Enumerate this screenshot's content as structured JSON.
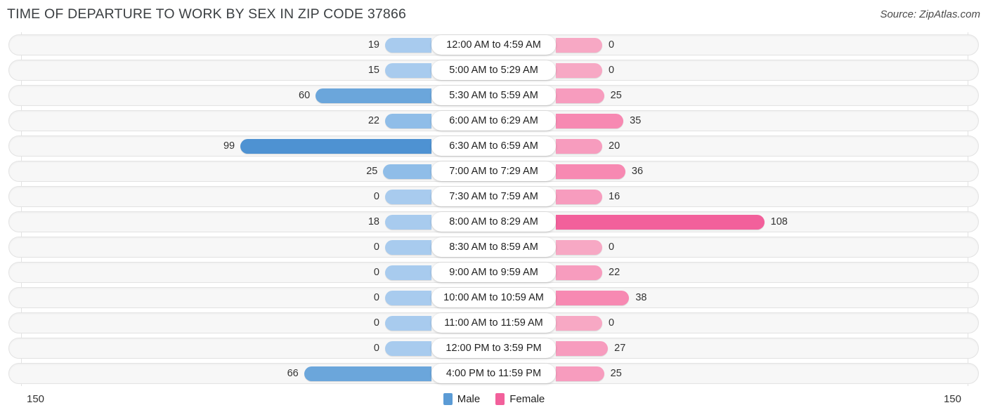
{
  "header": {
    "title": "TIME OF DEPARTURE TO WORK BY SEX IN ZIP CODE 37866",
    "source": "Source: ZipAtlas.com"
  },
  "legend": {
    "male_label": "Male",
    "female_label": "Female",
    "male_color": "#5b9bd5",
    "female_color": "#f2609b"
  },
  "axis": {
    "left_end": "150",
    "right_end": "150",
    "max": 150
  },
  "chart_data": {
    "type": "bar",
    "title": "TIME OF DEPARTURE TO WORK BY SEX IN ZIP CODE 37866",
    "subtitle": "Source: ZipAtlas.com",
    "orientation": "horizontal-diverging",
    "xlabel": "",
    "ylabel": "",
    "xlim": [
      150,
      150
    ],
    "grid": false,
    "legend_position": "bottom-center",
    "categories": [
      "12:00 AM to 4:59 AM",
      "5:00 AM to 5:29 AM",
      "5:30 AM to 5:59 AM",
      "6:00 AM to 6:29 AM",
      "6:30 AM to 6:59 AM",
      "7:00 AM to 7:29 AM",
      "7:30 AM to 7:59 AM",
      "8:00 AM to 8:29 AM",
      "8:30 AM to 8:59 AM",
      "9:00 AM to 9:59 AM",
      "10:00 AM to 10:59 AM",
      "11:00 AM to 11:59 AM",
      "12:00 PM to 3:59 PM",
      "4:00 PM to 11:59 PM"
    ],
    "series": [
      {
        "name": "Male",
        "values": [
          19,
          15,
          60,
          22,
          99,
          25,
          0,
          18,
          0,
          0,
          0,
          0,
          0,
          66
        ]
      },
      {
        "name": "Female",
        "values": [
          0,
          0,
          25,
          35,
          20,
          36,
          16,
          108,
          0,
          22,
          38,
          0,
          27,
          25
        ]
      }
    ]
  },
  "rows": [
    {
      "label": "12:00 AM to 4:59 AM",
      "male": "19",
      "female": "0"
    },
    {
      "label": "5:00 AM to 5:29 AM",
      "male": "15",
      "female": "0"
    },
    {
      "label": "5:30 AM to 5:59 AM",
      "male": "60",
      "female": "25"
    },
    {
      "label": "6:00 AM to 6:29 AM",
      "male": "22",
      "female": "35"
    },
    {
      "label": "6:30 AM to 6:59 AM",
      "male": "99",
      "female": "20"
    },
    {
      "label": "7:00 AM to 7:29 AM",
      "male": "25",
      "female": "36"
    },
    {
      "label": "7:30 AM to 7:59 AM",
      "male": "0",
      "female": "16"
    },
    {
      "label": "8:00 AM to 8:29 AM",
      "male": "18",
      "female": "108"
    },
    {
      "label": "8:30 AM to 8:59 AM",
      "male": "0",
      "female": "0"
    },
    {
      "label": "9:00 AM to 9:59 AM",
      "male": "0",
      "female": "22"
    },
    {
      "label": "10:00 AM to 10:59 AM",
      "male": "0",
      "female": "38"
    },
    {
      "label": "11:00 AM to 11:59 AM",
      "male": "0",
      "female": "0"
    },
    {
      "label": "12:00 PM to 3:59 PM",
      "male": "0",
      "female": "27"
    },
    {
      "label": "4:00 PM to 11:59 PM",
      "male": "66",
      "female": "25"
    }
  ]
}
